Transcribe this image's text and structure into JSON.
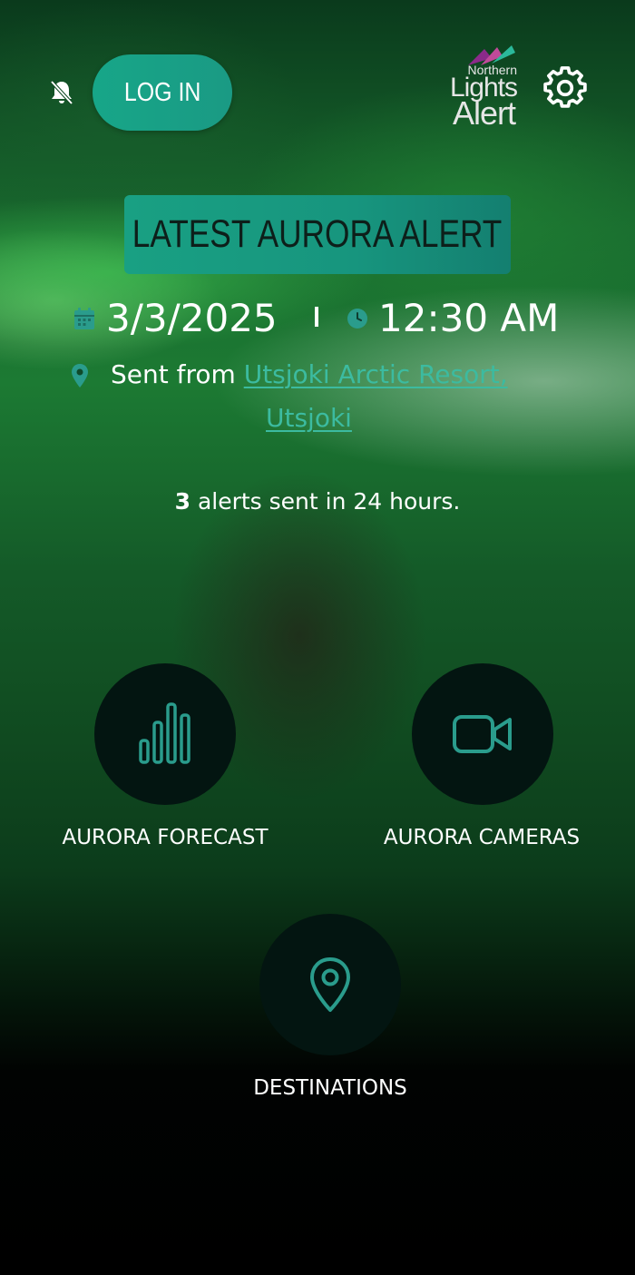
{
  "header": {
    "login_label": "LOG IN",
    "logo": {
      "line1": "Northern",
      "line2": "Lights",
      "line3": "Alert"
    }
  },
  "alert": {
    "banner_title": "LATEST AURORA ALERT",
    "date": "3/3/2025",
    "time": "12:30 AM",
    "sent_prefix": "Sent from",
    "location_line1": "Utsjoki Arctic Resort,",
    "location_line2": "Utsjoki",
    "count": "3",
    "count_suffix": " alerts sent in 24 hours."
  },
  "nav": {
    "forecast_label": "AURORA FORECAST",
    "cameras_label": "AURORA CAMERAS",
    "destinations_label": "DESTINATIONS"
  },
  "colors": {
    "accent": "#1aa386",
    "link": "#3cbba0",
    "icon": "#2a9c8c",
    "circle_bg": "#031511"
  },
  "icons": {
    "notifications": "bell-off-icon",
    "settings": "gear-icon",
    "date": "calendar-icon",
    "time": "clock-icon",
    "location": "map-pin-icon",
    "forecast": "bar-chart-icon",
    "cameras": "video-camera-icon",
    "destinations": "map-pin-outline-icon"
  }
}
